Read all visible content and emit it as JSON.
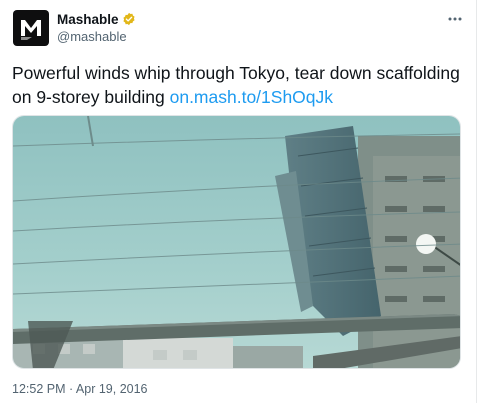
{
  "tweet": {
    "author": {
      "display_name": "Mashable",
      "handle": "@mashable",
      "avatar_letter": "M",
      "verified": true,
      "verified_color": "#e2b719"
    },
    "text_before_link": "Powerful winds whip through Tokyo, tear down scaffolding on 9-storey building ",
    "link_text": "on.mash.to/1ShOqJk",
    "more_icon": "more-horizontal-icon",
    "media": {
      "kind": "photo"
    },
    "timestamp": "12:52 PM · Apr 19, 2016"
  },
  "colors": {
    "text": "#0f1419",
    "secondary": "#536471",
    "link": "#1d9bf0",
    "border": "#e7e9ea"
  }
}
